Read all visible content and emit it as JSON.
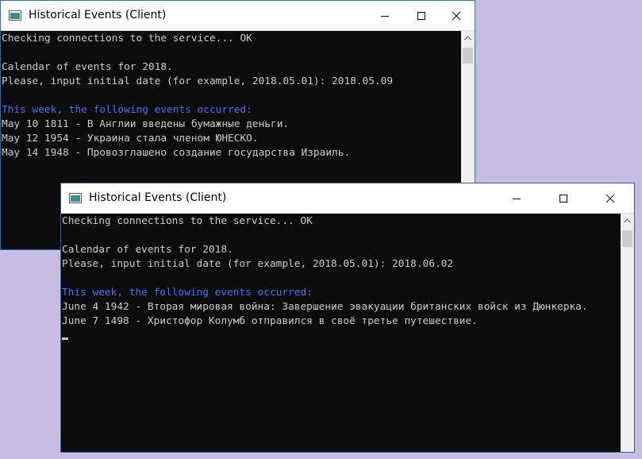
{
  "windows": [
    {
      "title": "Historical Events (Client)",
      "lines": [
        {
          "text": "Checking connections to the service... OK",
          "style": "normal"
        },
        {
          "text": "",
          "style": "normal"
        },
        {
          "text": "Calendar of events for 2018.",
          "style": "normal"
        },
        {
          "text": "Please, input initial date (for example, 2018.05.01): 2018.05.09",
          "style": "normal"
        },
        {
          "text": "",
          "style": "normal"
        },
        {
          "text": "This week, the following events occurred:",
          "style": "blue"
        },
        {
          "text": "May 10 1811 - В Англии введены бумажные деньги.",
          "style": "normal"
        },
        {
          "text": "May 12 1954 - Украина стала членом ЮНЕСКО.",
          "style": "normal"
        },
        {
          "text": "May 14 1948 - Провозглашено создание государства Израиль.",
          "style": "normal"
        }
      ]
    },
    {
      "title": "Historical Events (Client)",
      "lines": [
        {
          "text": "Checking connections to the service... OK",
          "style": "normal"
        },
        {
          "text": "",
          "style": "normal"
        },
        {
          "text": "Calendar of events for 2018.",
          "style": "normal"
        },
        {
          "text": "Please, input initial date (for example, 2018.05.01): 2018.06.02",
          "style": "normal"
        },
        {
          "text": "",
          "style": "normal"
        },
        {
          "text": "This week, the following events occurred:",
          "style": "blue"
        },
        {
          "text": "June 4 1942 - Вторая мировая война: Завершение эвакуации британских войск из Дюнкерка.",
          "style": "normal"
        },
        {
          "text": "June 7 1498 - Христофор Колумб отправился в своё третье путешествие.",
          "style": "normal"
        }
      ]
    }
  ],
  "colors": {
    "desktop": "#c7bde3",
    "console_bg": "#0c0c0c",
    "console_text": "#cccccc",
    "highlight_text": "#3b78ff",
    "window_border": "#1f6fcf"
  },
  "icons": [
    "console-app-icon",
    "minimize-icon",
    "maximize-icon",
    "close-icon",
    "scroll-up-arrow-icon"
  ]
}
